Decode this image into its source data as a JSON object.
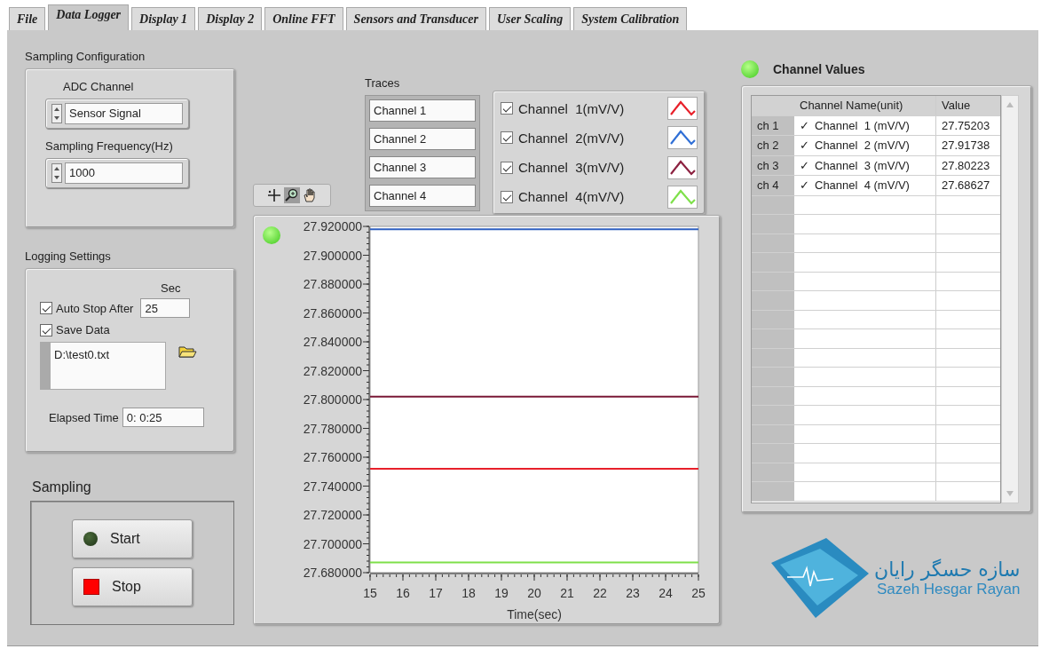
{
  "tabs": [
    {
      "label": "File",
      "selected": false
    },
    {
      "label": "Data Logger",
      "selected": true
    },
    {
      "label": "Display 1",
      "selected": false
    },
    {
      "label": "Display 2",
      "selected": false
    },
    {
      "label": "Online FFT",
      "selected": false
    },
    {
      "label": "Sensors and Transducer",
      "selected": false
    },
    {
      "label": "User Scaling",
      "selected": false
    },
    {
      "label": "System Calibration",
      "selected": false
    }
  ],
  "sampling_configuration": {
    "title": "Sampling Configuration",
    "adc_channel": {
      "label": "ADC Channel",
      "value": "Sensor Signal"
    },
    "sampling_frequency": {
      "label": "Sampling Frequency(Hz)",
      "value": "1000"
    }
  },
  "logging_settings": {
    "title": "Logging Settings",
    "sec_label": "Sec",
    "auto_stop": {
      "label": "Auto Stop After",
      "checked": true,
      "value": "25"
    },
    "save_data": {
      "label": "Save Data",
      "checked": true
    },
    "file_path": "D:\\test0.txt",
    "elapsed_time": {
      "label": "Elapsed Time",
      "value": "0: 0:25"
    }
  },
  "sampling": {
    "title": "Sampling",
    "buttons": [
      {
        "kind": "start",
        "label": "Start",
        "on": false
      },
      {
        "kind": "stop",
        "label": "Stop"
      }
    ]
  },
  "graph_palette": [
    {
      "kind": "cursor",
      "selected": false
    },
    {
      "kind": "zoom",
      "selected": true
    },
    {
      "kind": "pan",
      "selected": false
    }
  ],
  "traces": {
    "title": "Traces",
    "names": [
      "Channel 1",
      "Channel 2",
      "Channel 3",
      "Channel 4"
    ]
  },
  "legend": [
    {
      "label": "Channel  1(mV/V)",
      "checked": true,
      "color": "#e8202a"
    },
    {
      "label": "Channel  2(mV/V)",
      "checked": true,
      "color": "#2f6fd6"
    },
    {
      "label": "Channel  3(mV/V)",
      "checked": true,
      "color": "#8c2140"
    },
    {
      "label": "Channel  4(mV/V)",
      "checked": true,
      "color": "#7ee04a"
    }
  ],
  "graph": {
    "led_on": true,
    "chart_data": {
      "type": "line",
      "xlabel": "Time(sec)",
      "x": [
        15,
        25
      ],
      "xlim": [
        15,
        25
      ],
      "ylim": [
        27.68,
        27.92
      ],
      "xticks": [
        15,
        16,
        17,
        18,
        19,
        20,
        21,
        22,
        23,
        24,
        25
      ],
      "yticks": [
        {
          "value": 27.92,
          "label": "27.920000"
        },
        {
          "value": 27.9,
          "label": "27.900000"
        },
        {
          "value": 27.88,
          "label": "27.880000"
        },
        {
          "value": 27.86,
          "label": "27.860000"
        },
        {
          "value": 27.84,
          "label": "27.840000"
        },
        {
          "value": 27.82,
          "label": "27.820000"
        },
        {
          "value": 27.8,
          "label": "27.800000"
        },
        {
          "value": 27.78,
          "label": "27.780000"
        },
        {
          "value": 27.76,
          "label": "27.760000"
        },
        {
          "value": 27.74,
          "label": "27.740000"
        },
        {
          "value": 27.72,
          "label": "27.720000"
        },
        {
          "value": 27.7,
          "label": "27.700000"
        },
        {
          "value": 27.68,
          "label": "27.680000"
        }
      ],
      "series": [
        {
          "color": "#e8202a",
          "values": [
            27.752,
            27.752
          ]
        },
        {
          "color": "#2f5fc0",
          "values": [
            27.918,
            27.918
          ]
        },
        {
          "color": "#7a1836",
          "values": [
            27.802,
            27.802
          ]
        },
        {
          "color": "#7ee04a",
          "values": [
            27.687,
            27.687
          ]
        }
      ]
    }
  },
  "channel_values": {
    "title": "Channel Values",
    "led_on": true,
    "columns": [
      "Channel Name(unit)",
      "Value"
    ],
    "rows": [
      {
        "label": "ch 1",
        "mark": "✓",
        "name": "Channel  1 (mV/V)",
        "value": "27.75203"
      },
      {
        "label": "ch 2",
        "mark": "✓",
        "name": "Channel  2 (mV/V)",
        "value": "27.91738"
      },
      {
        "label": "ch 3",
        "mark": "✓",
        "name": "Channel  3 (mV/V)",
        "value": "27.80223"
      },
      {
        "label": "ch 4",
        "mark": "✓",
        "name": "Channel  4 (mV/V)",
        "value": "27.68627"
      }
    ]
  },
  "logo": {
    "name_fa": "سازه حسگر رایان",
    "name_en": "Sazeh Hesgar Rayan"
  }
}
